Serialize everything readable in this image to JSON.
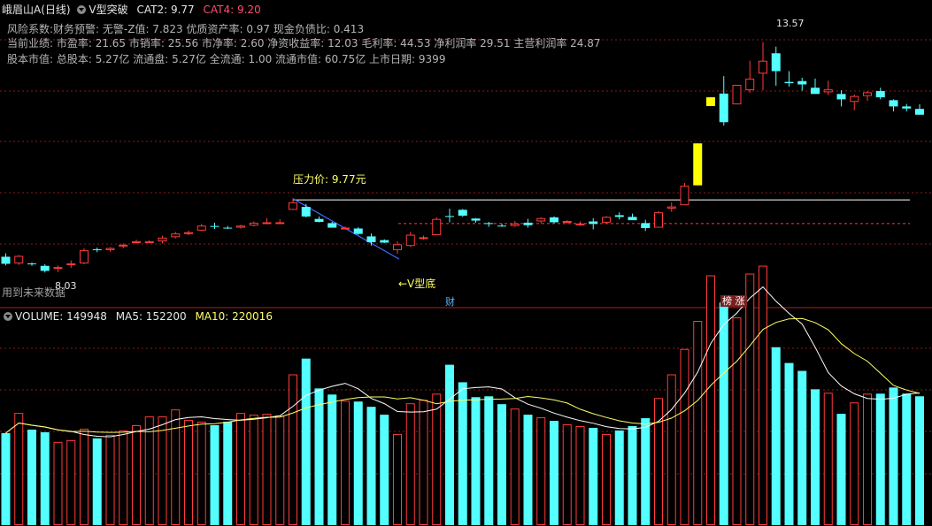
{
  "header": {
    "stock_name": "峨眉山A",
    "period": "(日线)",
    "indicator": "V型突破",
    "cat2_label": "CAT2: 9.77",
    "cat4_label": "CAT4: 9.20"
  },
  "info_lines": [
    "风险系数:财务预警: 无警-Z值: 7.823 优质资产率: 0.97 现金负债比: 0.413",
    "当前业绩: 市盈率: 21.65 市销率: 25.56 市净率: 2.60 净资收益率: 12.03 毛利率: 44.53 净利润率 29.51 主营利润率 24.87",
    "股本市值: 总股本: 5.27亿 流通盘: 5.27亿 全流通: 1.00 流通市值: 60.75亿 上市日期: 9399"
  ],
  "annotations": {
    "pressure_label": "压力价: 9.77元",
    "v_bottom_label": "←V型底",
    "high_label": "13.57",
    "low_label": "8.03",
    "future_data_note": "用到未来数据",
    "tag_cai": "财",
    "tag_bang": "榜 涨"
  },
  "volume_header": {
    "volume": "VOLUME: 149948",
    "ma5": "MA5: 152200",
    "ma10": "MA10: 220016"
  },
  "colors": {
    "up": "#ff3b3b",
    "down": "#54ffff",
    "limit_up": "#ffff00",
    "pressure_line": "#ffffff",
    "support_line": "#ff3b3b",
    "v_line": "#3d6bff",
    "ma5": "#ffffff",
    "ma10": "#ffff66",
    "grid": "#8b1a1a"
  },
  "chart_data": {
    "type": "candlestick",
    "price_range": [
      7.6,
      14.2
    ],
    "pressure_price": 9.77,
    "support_price": 9.2,
    "candles": [
      {
        "o": 8.4,
        "h": 8.48,
        "l": 8.19,
        "c": 8.23
      },
      {
        "o": 8.24,
        "h": 8.44,
        "l": 8.2,
        "c": 8.42
      },
      {
        "o": 8.24,
        "h": 8.26,
        "l": 8.18,
        "c": 8.22
      },
      {
        "o": 8.18,
        "h": 8.22,
        "l": 8.02,
        "c": 8.06
      },
      {
        "o": 8.13,
        "h": 8.19,
        "l": 8.03,
        "c": 8.15
      },
      {
        "o": 8.2,
        "h": 8.31,
        "l": 8.13,
        "c": 8.24
      },
      {
        "o": 8.24,
        "h": 8.6,
        "l": 8.22,
        "c": 8.56
      },
      {
        "o": 8.58,
        "h": 8.62,
        "l": 8.51,
        "c": 8.57
      },
      {
        "o": 8.56,
        "h": 8.63,
        "l": 8.52,
        "c": 8.61
      },
      {
        "o": 8.65,
        "h": 8.72,
        "l": 8.6,
        "c": 8.69
      },
      {
        "o": 8.74,
        "h": 8.81,
        "l": 8.72,
        "c": 8.77
      },
      {
        "o": 8.77,
        "h": 8.8,
        "l": 8.73,
        "c": 8.77
      },
      {
        "o": 8.77,
        "h": 8.91,
        "l": 8.72,
        "c": 8.86
      },
      {
        "o": 8.87,
        "h": 9.0,
        "l": 8.84,
        "c": 8.96
      },
      {
        "o": 8.96,
        "h": 9.03,
        "l": 8.92,
        "c": 8.99
      },
      {
        "o": 9.03,
        "h": 9.19,
        "l": 9.03,
        "c": 9.15
      },
      {
        "o": 9.14,
        "h": 9.22,
        "l": 9.07,
        "c": 9.12
      },
      {
        "o": 9.1,
        "h": 9.14,
        "l": 9.07,
        "c": 9.08
      },
      {
        "o": 9.1,
        "h": 9.17,
        "l": 9.08,
        "c": 9.15
      },
      {
        "o": 9.15,
        "h": 9.25,
        "l": 9.13,
        "c": 9.22
      },
      {
        "o": 9.22,
        "h": 9.33,
        "l": 9.18,
        "c": 9.23
      },
      {
        "o": 9.23,
        "h": 9.3,
        "l": 9.2,
        "c": 9.23
      },
      {
        "o": 9.53,
        "h": 9.8,
        "l": 9.53,
        "c": 9.71
      },
      {
        "o": 9.6,
        "h": 9.67,
        "l": 9.35,
        "c": 9.37
      },
      {
        "o": 9.31,
        "h": 9.37,
        "l": 9.23,
        "c": 9.24
      },
      {
        "o": 9.21,
        "h": 9.24,
        "l": 9.1,
        "c": 9.1
      },
      {
        "o": 9.1,
        "h": 9.13,
        "l": 9.06,
        "c": 9.1
      },
      {
        "o": 9.08,
        "h": 9.11,
        "l": 8.93,
        "c": 8.95
      },
      {
        "o": 8.89,
        "h": 8.96,
        "l": 8.67,
        "c": 8.75
      },
      {
        "o": 8.8,
        "h": 8.82,
        "l": 8.73,
        "c": 8.74
      },
      {
        "o": 8.56,
        "h": 8.77,
        "l": 8.47,
        "c": 8.7
      },
      {
        "o": 8.66,
        "h": 9.0,
        "l": 8.64,
        "c": 8.93
      },
      {
        "o": 8.84,
        "h": 8.91,
        "l": 8.81,
        "c": 8.87
      },
      {
        "o": 8.92,
        "h": 9.35,
        "l": 8.92,
        "c": 9.31
      },
      {
        "o": 9.38,
        "h": 9.56,
        "l": 9.23,
        "c": 9.37
      },
      {
        "o": 9.53,
        "h": 9.55,
        "l": 9.36,
        "c": 9.39
      },
      {
        "o": 9.32,
        "h": 9.33,
        "l": 9.22,
        "c": 9.27
      },
      {
        "o": 9.21,
        "h": 9.24,
        "l": 9.12,
        "c": 9.2
      },
      {
        "o": 9.15,
        "h": 9.2,
        "l": 9.12,
        "c": 9.14
      },
      {
        "o": 9.14,
        "h": 9.26,
        "l": 9.12,
        "c": 9.2
      },
      {
        "o": 9.22,
        "h": 9.31,
        "l": 9.1,
        "c": 9.16
      },
      {
        "o": 9.25,
        "h": 9.35,
        "l": 9.2,
        "c": 9.33
      },
      {
        "o": 9.35,
        "h": 9.37,
        "l": 9.21,
        "c": 9.23
      },
      {
        "o": 9.22,
        "h": 9.28,
        "l": 9.2,
        "c": 9.26
      },
      {
        "o": 9.19,
        "h": 9.25,
        "l": 9.14,
        "c": 9.2
      },
      {
        "o": 9.25,
        "h": 9.33,
        "l": 9.06,
        "c": 9.19
      },
      {
        "o": 9.22,
        "h": 9.38,
        "l": 9.2,
        "c": 9.36
      },
      {
        "o": 9.4,
        "h": 9.47,
        "l": 9.3,
        "c": 9.36
      },
      {
        "o": 9.36,
        "h": 9.44,
        "l": 9.29,
        "c": 9.28
      },
      {
        "o": 9.21,
        "h": 9.29,
        "l": 9.02,
        "c": 9.09
      },
      {
        "o": 9.1,
        "h": 9.5,
        "l": 9.1,
        "c": 9.47
      },
      {
        "o": 9.56,
        "h": 9.71,
        "l": 9.48,
        "c": 9.61
      },
      {
        "o": 9.64,
        "h": 10.18,
        "l": 9.64,
        "c": 10.11
      },
      {
        "o": 10.12,
        "h": 11.13,
        "l": 10.12,
        "c": 11.13
      },
      {
        "o": 12.03,
        "h": 12.24,
        "l": 12.03,
        "c": 12.24
      },
      {
        "o": 12.33,
        "h": 12.75,
        "l": 11.56,
        "c": 11.64
      },
      {
        "o": 12.07,
        "h": 12.54,
        "l": 12.07,
        "c": 12.54
      },
      {
        "o": 12.41,
        "h": 13.12,
        "l": 12.35,
        "c": 12.69
      },
      {
        "o": 12.81,
        "h": 13.57,
        "l": 12.41,
        "c": 13.12
      },
      {
        "o": 13.3,
        "h": 13.46,
        "l": 12.52,
        "c": 12.87
      },
      {
        "o": 12.61,
        "h": 12.87,
        "l": 12.5,
        "c": 12.58
      },
      {
        "o": 12.63,
        "h": 12.71,
        "l": 12.4,
        "c": 12.55
      },
      {
        "o": 12.47,
        "h": 12.69,
        "l": 12.36,
        "c": 12.32
      },
      {
        "o": 12.36,
        "h": 12.64,
        "l": 12.29,
        "c": 12.43
      },
      {
        "o": 12.32,
        "h": 12.41,
        "l": 12.02,
        "c": 12.19
      },
      {
        "o": 12.13,
        "h": 12.31,
        "l": 11.93,
        "c": 12.27
      },
      {
        "o": 12.27,
        "h": 12.39,
        "l": 12.15,
        "c": 12.36
      },
      {
        "o": 12.39,
        "h": 12.47,
        "l": 12.19,
        "c": 12.24
      },
      {
        "o": 12.17,
        "h": 12.19,
        "l": 11.9,
        "c": 12.02
      },
      {
        "o": 12.02,
        "h": 12.08,
        "l": 11.9,
        "c": 11.97
      },
      {
        "o": 11.96,
        "h": 12.07,
        "l": 11.83,
        "c": 11.82
      }
    ],
    "volume_range": [
      0,
      230000
    ],
    "volume": [
      105000,
      128000,
      109000,
      106000,
      95000,
      97000,
      110000,
      99000,
      103000,
      108000,
      114000,
      124000,
      124000,
      132000,
      120000,
      118000,
      114000,
      118000,
      128000,
      126000,
      127000,
      125000,
      172000,
      190000,
      156000,
      149000,
      142000,
      141000,
      135000,
      126000,
      104000,
      139000,
      143000,
      150000,
      183000,
      163000,
      146000,
      147000,
      138000,
      133000,
      126000,
      123000,
      119000,
      115000,
      113000,
      111000,
      104000,
      108000,
      113000,
      122000,
      145000,
      172000,
      201000,
      233000,
      285000,
      254000,
      237000,
      287000,
      296000,
      203000,
      185000,
      176000,
      155000,
      151000,
      127000,
      140000,
      150000,
      150000,
      157000,
      150000,
      147000
    ]
  }
}
